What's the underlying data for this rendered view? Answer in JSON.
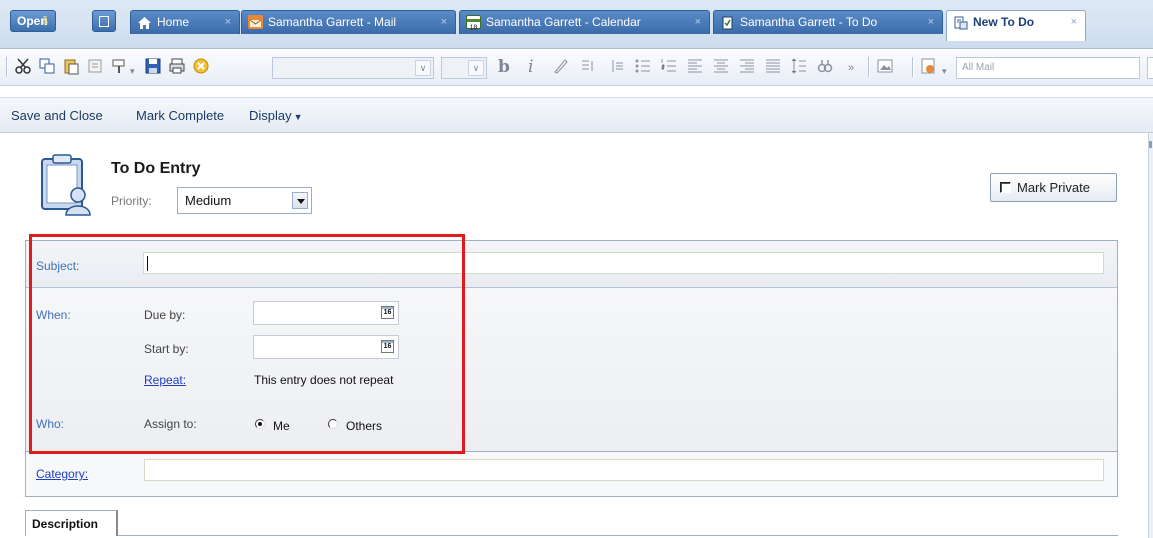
{
  "tabbar": {
    "open_label": "Open",
    "tabs": [
      {
        "label": "Home",
        "icon": "house-icon",
        "close": "×"
      },
      {
        "label": "Samantha Garrett - Mail",
        "icon": "mail-icon",
        "close": "×"
      },
      {
        "label": "Samantha Garrett - Calendar",
        "icon": "calendar-icon",
        "close": "×"
      },
      {
        "label": "Samantha Garrett - To Do",
        "icon": "checklist-icon",
        "close": "×"
      },
      {
        "label": "New To Do",
        "icon": "new-todo-icon",
        "close": "×"
      }
    ]
  },
  "toolbar": {
    "bold_glyph": "b",
    "italic_glyph": "i",
    "search_placeholder": "All Mail"
  },
  "actions": {
    "save_close": "Save and Close",
    "mark_complete": "Mark Complete",
    "display": "Display"
  },
  "header": {
    "title": "To Do Entry",
    "priority_label": "Priority:",
    "priority_value": "Medium",
    "mark_private": "Mark Private"
  },
  "form": {
    "subject_label": "Subject:",
    "subject_value": "",
    "when_label": "When:",
    "due_by_label": "Due by:",
    "start_by_label": "Start by:",
    "calendar_day": "16",
    "repeat_label": "Repeat:",
    "repeat_text": "This entry does not repeat",
    "who_label": "Who:",
    "assign_to_label": "Assign to:",
    "assign_options": [
      {
        "label": "Me",
        "selected": true
      },
      {
        "label": "Others",
        "selected": false
      }
    ],
    "category_label": "Category:",
    "category_value": ""
  },
  "description_tab": "Description",
  "colors": {
    "highlight": "#e01b1b",
    "label_blue": "#3f72b5",
    "link_blue": "#1f3fc0",
    "tab_blue": "#3b6aa8"
  }
}
